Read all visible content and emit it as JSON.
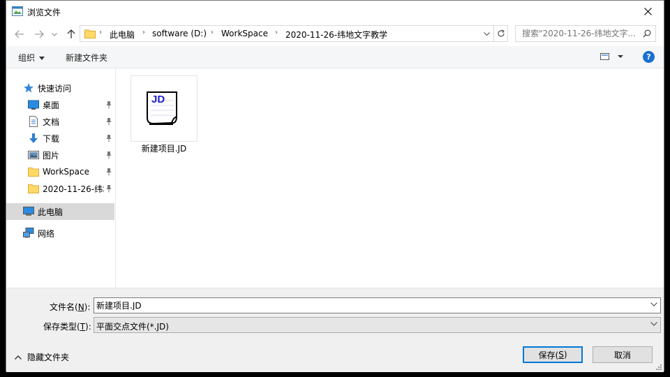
{
  "window": {
    "title": "浏览文件"
  },
  "address": {
    "crumbs": [
      "此电脑",
      "software (D:)",
      "WorkSpace",
      "2020-11-26-纬地文字教学"
    ]
  },
  "search": {
    "placeholder": "搜索\"2020-11-26-纬地文字..."
  },
  "toolbar": {
    "organize_label": "组织",
    "newfolder_label": "新建文件夹",
    "help_label": "?"
  },
  "sidebar": {
    "items": [
      {
        "label": "快速访问",
        "icon": "star-icon",
        "pinned": false
      },
      {
        "label": "桌面",
        "icon": "desktop-icon",
        "pinned": true
      },
      {
        "label": "文档",
        "icon": "document-icon",
        "pinned": true
      },
      {
        "label": "下载",
        "icon": "download-icon",
        "pinned": true
      },
      {
        "label": "图片",
        "icon": "picture-icon",
        "pinned": true
      },
      {
        "label": "WorkSpace",
        "icon": "folder-icon",
        "pinned": true
      },
      {
        "label": "2020-11-26-纬地",
        "icon": "folder-icon",
        "pinned": true
      },
      {
        "label": "此电脑",
        "icon": "computer-icon",
        "pinned": false,
        "selected": true
      },
      {
        "label": "网络",
        "icon": "network-icon",
        "pinned": false
      }
    ]
  },
  "files": [
    {
      "name": "新建项目.JD",
      "thumb_text": "JD"
    }
  ],
  "form": {
    "filename_label": "文件名(",
    "filename_key": "N",
    "filename_label_end": "):",
    "filename_value": "新建项目.JD",
    "filetype_label": "保存类型(",
    "filetype_key": "T",
    "filetype_label_end": "):",
    "filetype_value": "平面交点文件(*.JD)"
  },
  "buttons": {
    "hide_folders": "隐藏文件夹",
    "save_label": "保存(",
    "save_key": "S",
    "save_end": ")",
    "cancel": "取消"
  },
  "colors": {
    "accent": "#0078d7",
    "help": "#1a6fd1",
    "selected": "#d9d9d9",
    "folder": "#ffd966",
    "jd_text": "#1f1fd0"
  }
}
